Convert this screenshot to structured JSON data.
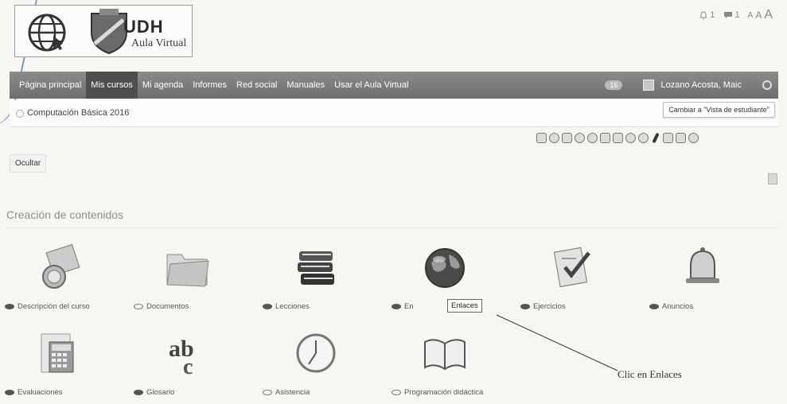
{
  "header": {
    "brand_name": "UDH",
    "brand_sub": "Aula Virtual",
    "notifications_count": "1",
    "messages_count": "1",
    "font_small": "A",
    "font_mid": "A",
    "font_big": "A"
  },
  "nav": {
    "items": [
      "Página principal",
      "Mis cursos",
      "Mi agenda",
      "Informes",
      "Red social",
      "Manuales",
      "Usar el Aula Virtual"
    ],
    "badge": "16",
    "user": "Lozano Acosta, Maic"
  },
  "breadcrumb": {
    "course": "Computación Básica 2016",
    "switch_view": "Cambiar a \"Vista de estudiante\""
  },
  "hide_button": "Ocultar",
  "section_title": "Creación de contenidos",
  "tools": [
    {
      "label": "Descripción del curso",
      "icon": "course-description-icon",
      "visible": true
    },
    {
      "label": "Documentos",
      "icon": "documents-folder-icon",
      "visible": false
    },
    {
      "label": "Lecciones",
      "icon": "lessons-books-icon",
      "visible": true
    },
    {
      "label": "En",
      "icon": "links-globe-icon",
      "visible": true
    },
    {
      "label": "Ejercicios",
      "icon": "exercises-icon",
      "visible": true
    },
    {
      "label": "Anuncios",
      "icon": "announcements-bell-icon",
      "visible": true
    },
    {
      "label": "Evaluaciones",
      "icon": "gradebook-calculator-icon",
      "visible": true
    },
    {
      "label": "Glosario",
      "icon": "glossary-abc-icon",
      "visible": true
    },
    {
      "label": "Asistencia",
      "icon": "attendance-clock-icon",
      "visible": false
    },
    {
      "label": "Programación didáctica",
      "icon": "syllabus-book-icon",
      "visible": false
    }
  ],
  "tooltip": "Enlaces",
  "annotation": "Clic en Enlaces",
  "colors": {
    "nav_bg": "#7d7d7d",
    "nav_active": "#4e4e4e",
    "page_bg": "#f6f6f3"
  }
}
